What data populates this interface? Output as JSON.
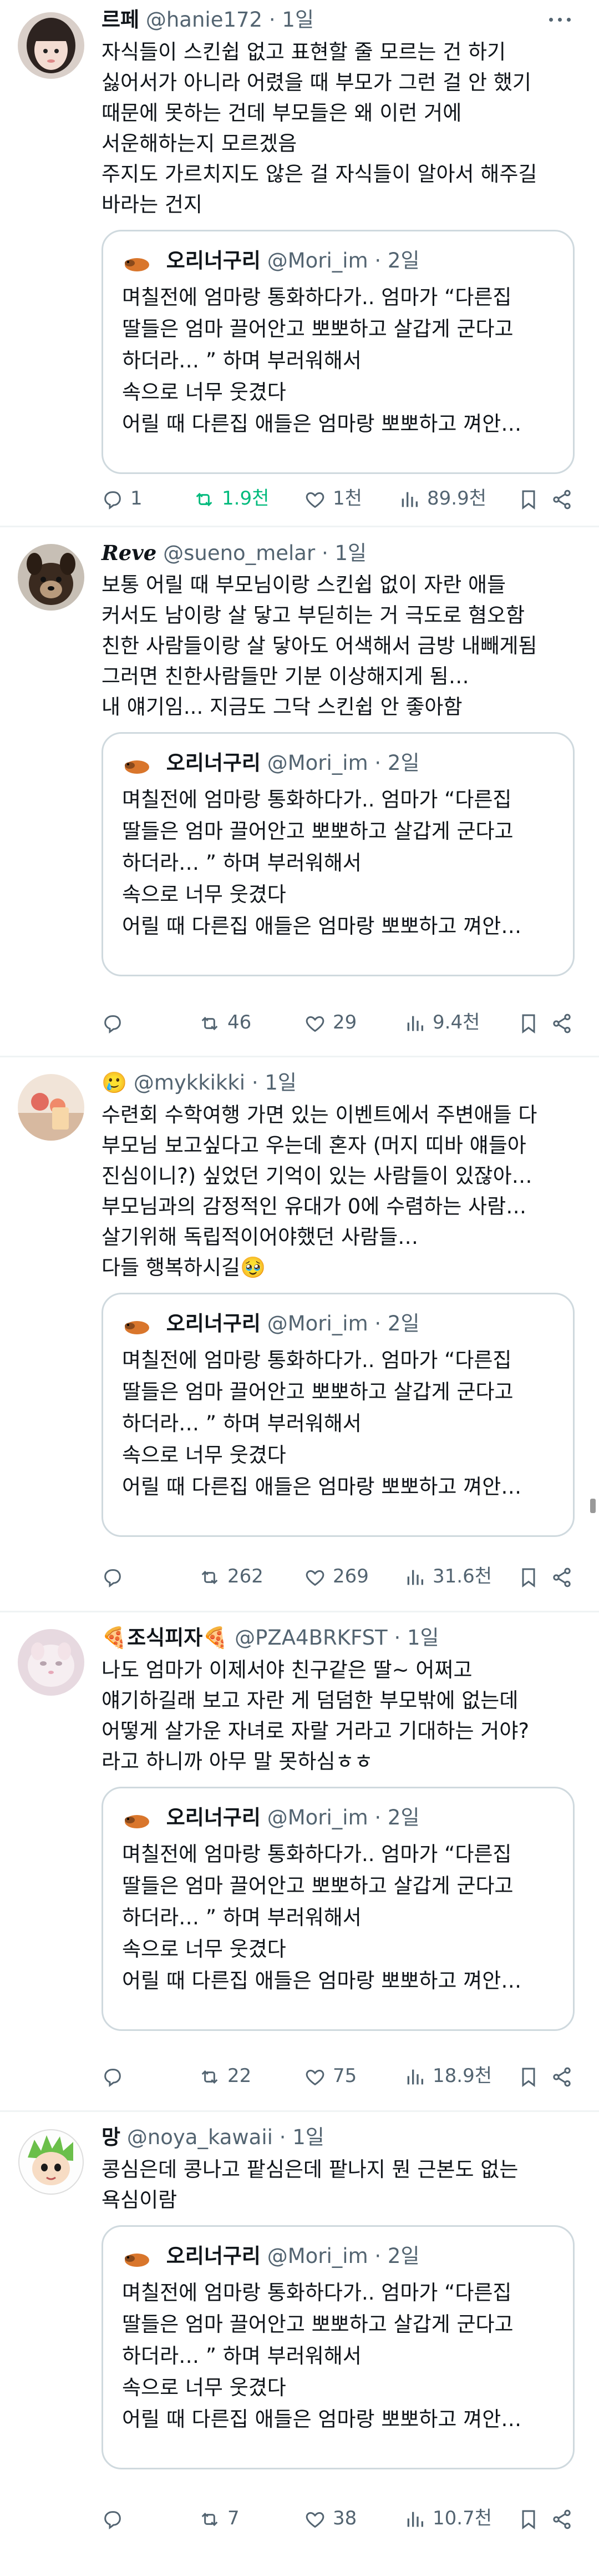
{
  "quoted": {
    "name": "오리너구리",
    "handle": "@Mori_im",
    "sep": "·",
    "time": "2일",
    "text": "며칠전에 엄마랑 통화하다가.. 엄마가 “다른집\n딸들은 엄마 끌어안고 뽀뽀하고 살갑게 군다고\n하더라… ” 하며 부러워해서\n속으로 너무 웃겼다\n어릴 때 다른집 애들은 엄마랑 뽀뽀하고 껴안…"
  },
  "posts": [
    {
      "name": "르페",
      "handle": "@hanie172",
      "sep": "·",
      "time": "1일",
      "text": "자식들이 스킨쉽 없고 표현할 줄 모르는 건 하기\n싫어서가 아니라 어렸을 때 부모가 그런 걸 안 했기\n때문에 못하는 건데 부모들은 왜 이런 거에\n서운해하는지 모르겠음\n주지도 가르치지도 않은 걸 자식들이 알아서 해주길\n바라는 건지",
      "replies": "1",
      "reposts": "1.9천",
      "likes": "1천",
      "views": "89.9천"
    },
    {
      "name": "Reve",
      "handle": "@sueno_melar",
      "sep": "·",
      "time": "1일",
      "text": "보통 어릴 때 부모님이랑 스킨쉽 없이 자란 애들\n커서도 남이랑 살 닿고 부딛히는 거 극도로 혐오함\n친한 사람들이랑 살 닿아도 어색해서 금방 내빼게됨\n그러면 친한사람들만 기분 이상해지게 됨…\n내 얘기임... 지금도 그닥 스킨쉽 안 좋아함",
      "replies": "",
      "reposts": "46",
      "likes": "29",
      "views": "9.4천"
    },
    {
      "name": "🥲",
      "handle": "@mykkikki",
      "sep": "·",
      "time": "1일",
      "text": "수련회 수학여행 가면 있는 이벤트에서 주변애들 다\n부모님 보고싶다고 우는데 혼자 (머지 띠바 얘들아\n진심이니?) 싶었던 기억이 있는 사람들이 있잖아…\n부모님과의 감정적인 유대가 0에 수렴하는 사람…\n살기위해 독립적이어야했던 사람들…\n다들 행복하시길🥹",
      "replies": "",
      "reposts": "262",
      "likes": "269",
      "views": "31.6천"
    },
    {
      "name": "🍕조식피자🍕",
      "handle": "@PZA4BRKFST",
      "sep": "·",
      "time": "1일",
      "text": "나도 엄마가 이제서야 친구같은 딸~ 어쩌고\n얘기하길래 보고 자란 게 덤덤한 부모밖에 없는데\n어떻게 살가운 자녀로 자랄 거라고 기대하는 거야?\n라고 하니까 아무 말 못하심ㅎㅎ",
      "replies": "",
      "reposts": "22",
      "likes": "75",
      "views": "18.9천"
    },
    {
      "name": "망",
      "handle": "@noya_kawaii",
      "sep": "·",
      "time": "1일",
      "text": "콩심은데 콩나고 팥심은데 팥나지 뭔 근본도 없는\n욕심이람",
      "replies": "",
      "reposts": "7",
      "likes": "38",
      "views": "10.7천"
    }
  ]
}
